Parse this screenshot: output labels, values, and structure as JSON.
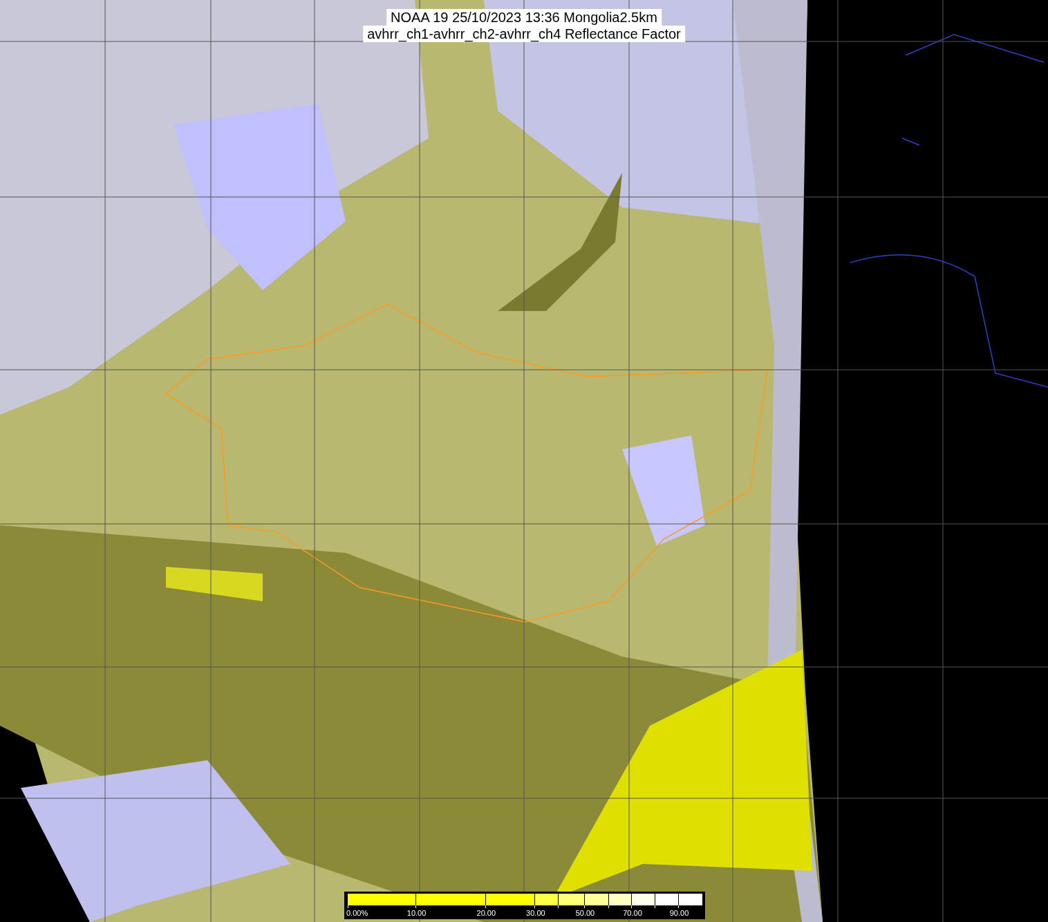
{
  "title": {
    "lines": [
      "NOAA 19 25/10/2023 13:36 Mongolia2.5km",
      "avhrr_ch1-avhrr_ch2-avhrr_ch4 Reflectance Factor"
    ]
  },
  "legend": {
    "segments": [
      {
        "color": "#ffff00",
        "label": "0.00%"
      },
      {
        "color": "#ffff00",
        "label": "10.00"
      },
      {
        "color": "#ffff00",
        "label": "20.00"
      },
      {
        "color": "#ffff44",
        "label": "30.00"
      },
      {
        "color": "#ffff77"
      },
      {
        "color": "#ffff99",
        "label": "50.00"
      },
      {
        "color": "#ffffc4"
      },
      {
        "color": "#ffffea",
        "label": "70.00"
      },
      {
        "color": "#ffffff"
      },
      {
        "color": "#ffffff",
        "label": "90.00"
      }
    ]
  }
}
